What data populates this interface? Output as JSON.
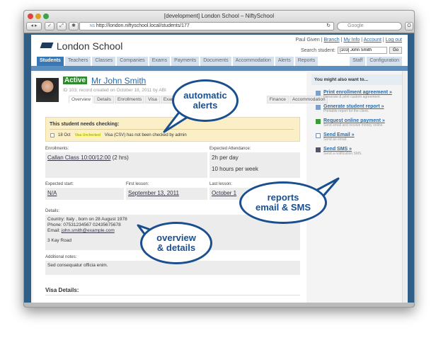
{
  "browser": {
    "title": "[development] London School – NiftySchool",
    "url": "http://london.niftyschool.local/students/177",
    "url_prefix": "NS",
    "search_placeholder": "Google"
  },
  "header": {
    "brand": "London School",
    "user": "Paul Given",
    "links": [
      "Branch",
      "My Info",
      "Account",
      "Log out"
    ],
    "search_label": "Search student:",
    "search_value": "[103] John Smith",
    "go": "Go"
  },
  "nav": {
    "tabs": [
      "Students",
      "Teachers",
      "Classes",
      "Companies",
      "Exams",
      "Payments",
      "Documents",
      "Accommodation",
      "Alerts",
      "Reports"
    ],
    "right_tabs": [
      "Staff",
      "Configuration"
    ],
    "active": "Students"
  },
  "student": {
    "status": "Active",
    "name": "Mr John Smith",
    "meta": "ID 103, record created on October 18, 2011 by ABI",
    "tabs": [
      "Overview",
      "Details",
      "Enrollments",
      "Visa",
      "Exams",
      "",
      "Finance",
      "Accommodation"
    ],
    "alert": {
      "title": "This student needs checking:",
      "date": "18 Oct",
      "tag": "Visa Unchecked",
      "text": "Visa (CSV) has not been checked by admin"
    },
    "enrollments_label": "Enrollments:",
    "enrollment": "Callan Class 10:00/12:00",
    "enrollment_suffix": "(2 hrs)",
    "attendance_label": "Expected Attendance:",
    "attendance": [
      "2h per day",
      "10 hours per week"
    ],
    "start_label": "Expected start:",
    "start": "N/A",
    "first_label": "First lesson:",
    "first": "September 13, 2011",
    "last_label": "Last lesson:",
    "last": "October 1",
    "details_label": "Details:",
    "details": [
      "Country: Italy , born on 28 August 1978",
      "Phone: 07531234567  02435675678"
    ],
    "email_label": "Email:",
    "email": "john.smith@example.com",
    "address": "3 Kay Road",
    "notes_label": "Additional notes:",
    "notes": "Sed consequatur officia enim.",
    "visa_label": "Visa Details:"
  },
  "sidebar": {
    "title": "You might also want to...",
    "items": [
      {
        "label": "Print enrollment agreement »",
        "desc": "Generate & print custom agreement.",
        "icon": "document-icon"
      },
      {
        "label": "Generate student report »",
        "desc": "Printable report for the client.",
        "icon": "report-icon"
      },
      {
        "label": "Request online payment »",
        "desc": "Send email and receive money online.",
        "icon": "money-icon"
      },
      {
        "label": "Send Email »",
        "desc": "Send an email.",
        "icon": "envelope-icon"
      },
      {
        "label": "Send SMS »",
        "desc": "Send a notification SMS.",
        "icon": "phone-icon"
      }
    ]
  },
  "callouts": [
    {
      "line1": "automatic",
      "line2": "alerts"
    },
    {
      "line1": "reports",
      "line2": "email & SMS"
    },
    {
      "line1": "overview",
      "line2": "& details"
    }
  ]
}
